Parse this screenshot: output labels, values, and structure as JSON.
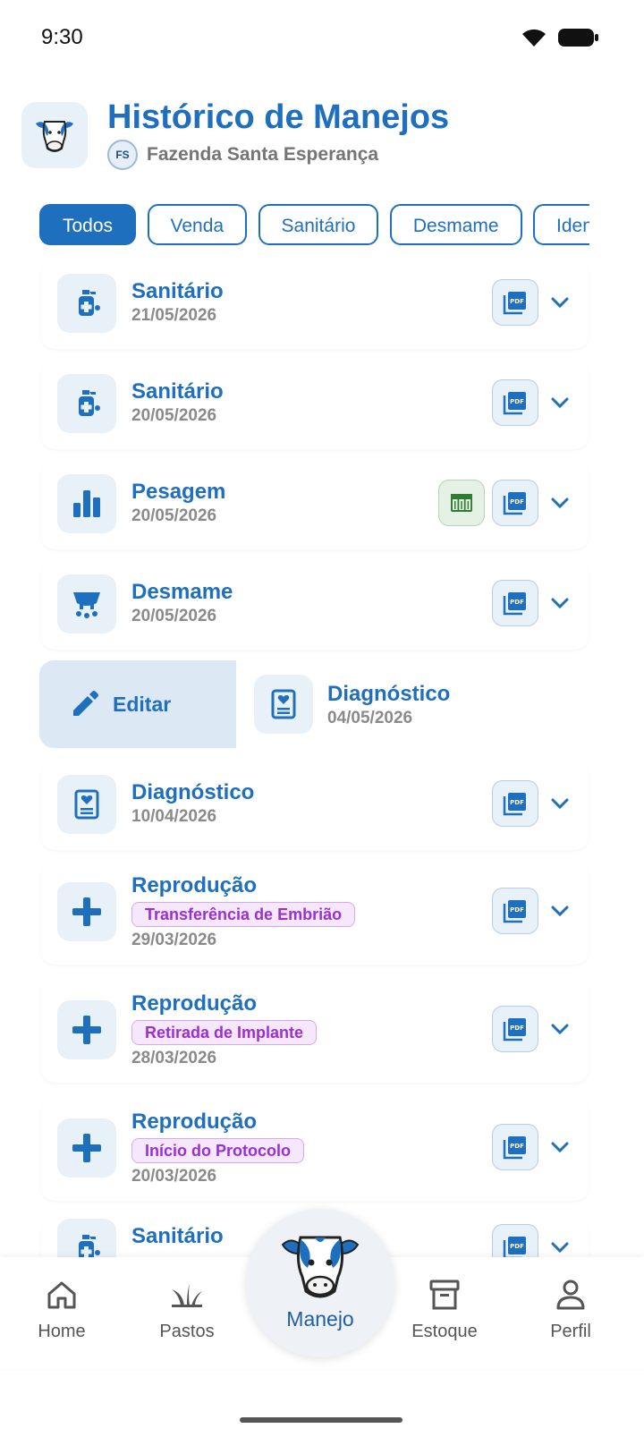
{
  "status": {
    "time": "9:30"
  },
  "header": {
    "title": "Histórico de Manejos",
    "farm_initials": "FS",
    "farm_name": "Fazenda Santa Esperança"
  },
  "filters": [
    "Todos",
    "Venda",
    "Sanitário",
    "Desmame",
    "Identi"
  ],
  "active_filter": "Todos",
  "records": [
    {
      "title": "Sanitário",
      "date": "21/05/2026",
      "icon": "sanitary-spray-icon"
    },
    {
      "title": "Sanitário",
      "date": "20/05/2026",
      "icon": "sanitary-spray-icon"
    },
    {
      "title": "Pesagem",
      "date": "20/05/2026",
      "icon": "bar-chart-icon",
      "has_sheet": true
    },
    {
      "title": "Desmame",
      "date": "20/05/2026",
      "icon": "udder-icon"
    },
    {
      "title": "Diagnóstico",
      "date": "04/05/2026",
      "icon": "diagnosis-card-icon",
      "swiped": true,
      "swipe_action": "Editar"
    },
    {
      "title": "Diagnóstico",
      "date": "10/04/2026",
      "icon": "diagnosis-card-icon"
    },
    {
      "title": "Reprodução",
      "tag": "Transferência de Embrião",
      "date": "29/03/2026",
      "icon": "plus-icon"
    },
    {
      "title": "Reprodução",
      "tag": "Retirada de Implante",
      "date": "28/03/2026",
      "icon": "plus-icon"
    },
    {
      "title": "Reprodução",
      "tag": "Início do Protocolo",
      "date": "20/03/2026",
      "icon": "plus-icon"
    },
    {
      "title": "Sanitário",
      "date": "",
      "icon": "sanitary-spray-icon"
    }
  ],
  "pdf_label": "PDF",
  "nav": {
    "home": "Home",
    "pastos": "Pastos",
    "manejo": "Manejo",
    "estoque": "Estoque",
    "perfil": "Perfil"
  },
  "colors": {
    "primary": "#1f6fbf",
    "tag_purple": "#9c2fd0",
    "sheet_green": "#2e7d32"
  }
}
